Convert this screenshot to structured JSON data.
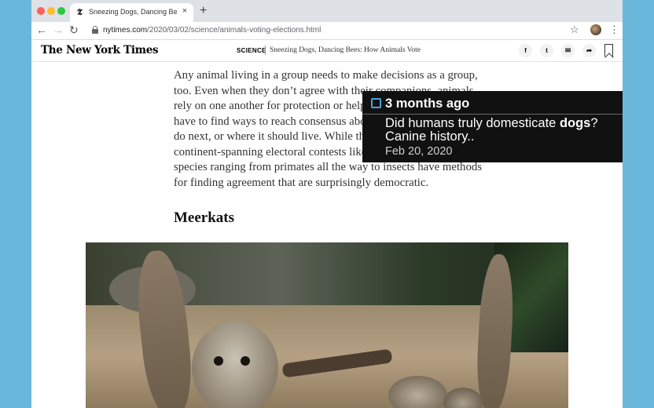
{
  "browser": {
    "tab_title": "Sneezing Dogs, Dancing Bees",
    "tab_favicon": "𝕿",
    "new_tab_label": "+",
    "close_label": "×",
    "url_host": "nytimes.com",
    "url_path": "/2020/03/02/science/animals-voting-elections.html",
    "back_icon": "←",
    "forward_icon": "→",
    "reload_icon": "↻",
    "star_icon": "☆",
    "menu_icon": "⋮"
  },
  "header": {
    "logo": "The New York Times",
    "section": "SCIENCE",
    "headline": "Sneezing Dogs, Dancing Bees: How Animals Vote",
    "share": {
      "facebook": "f",
      "twitter": "t",
      "email": "✉",
      "more": "➦"
    }
  },
  "article": {
    "paragraph": "Any animal living in a group needs to make decisions as a group, too. Even when they don’t agree with their companions, animals rely on one another for protection or help finding food. So they have to find ways to reach consensus about where to go, what to do next, or where it should live. While they may not hold continent-spanning electoral contests like this Super Tuesday, species ranging from primates all the way to insects have methods for finding agreement that are surprisingly democratic.",
    "subhead": "Meerkats"
  },
  "popup": {
    "time": "3 months ago",
    "title_before": "Did humans truly domesticate ",
    "title_bold": "dogs",
    "title_after": "? Canine history..",
    "date": "Feb 20, 2020",
    "accent_color": "#4aa3d8"
  },
  "colors": {
    "page_bg": "#6ab7dc",
    "popup_bg": "#111111"
  }
}
